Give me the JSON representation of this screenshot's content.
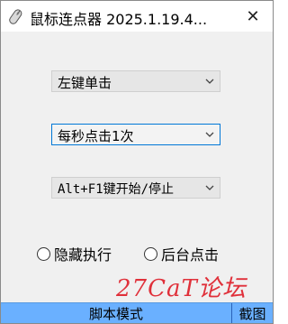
{
  "window": {
    "title": "鼠标连点器 2025.1.19.4...",
    "close_glyph": "✕"
  },
  "controls": {
    "click_type": {
      "selected": "左键单击"
    },
    "frequency": {
      "selected": "每秒点击1次"
    },
    "hotkey": {
      "selected": "Alt+F1键开始/停止"
    }
  },
  "radios": {
    "hidden_exec": {
      "label": "隐藏执行",
      "checked": false
    },
    "background_click": {
      "label": "后台点击",
      "checked": false
    }
  },
  "statusbar": {
    "mode": "脚本模式",
    "screenshot": "截图"
  },
  "watermark": {
    "text": "27CaT论坛"
  },
  "colors": {
    "status_bg": "#6ab0ff",
    "focus_border": "#0078d7",
    "watermark": "#e0303a"
  }
}
